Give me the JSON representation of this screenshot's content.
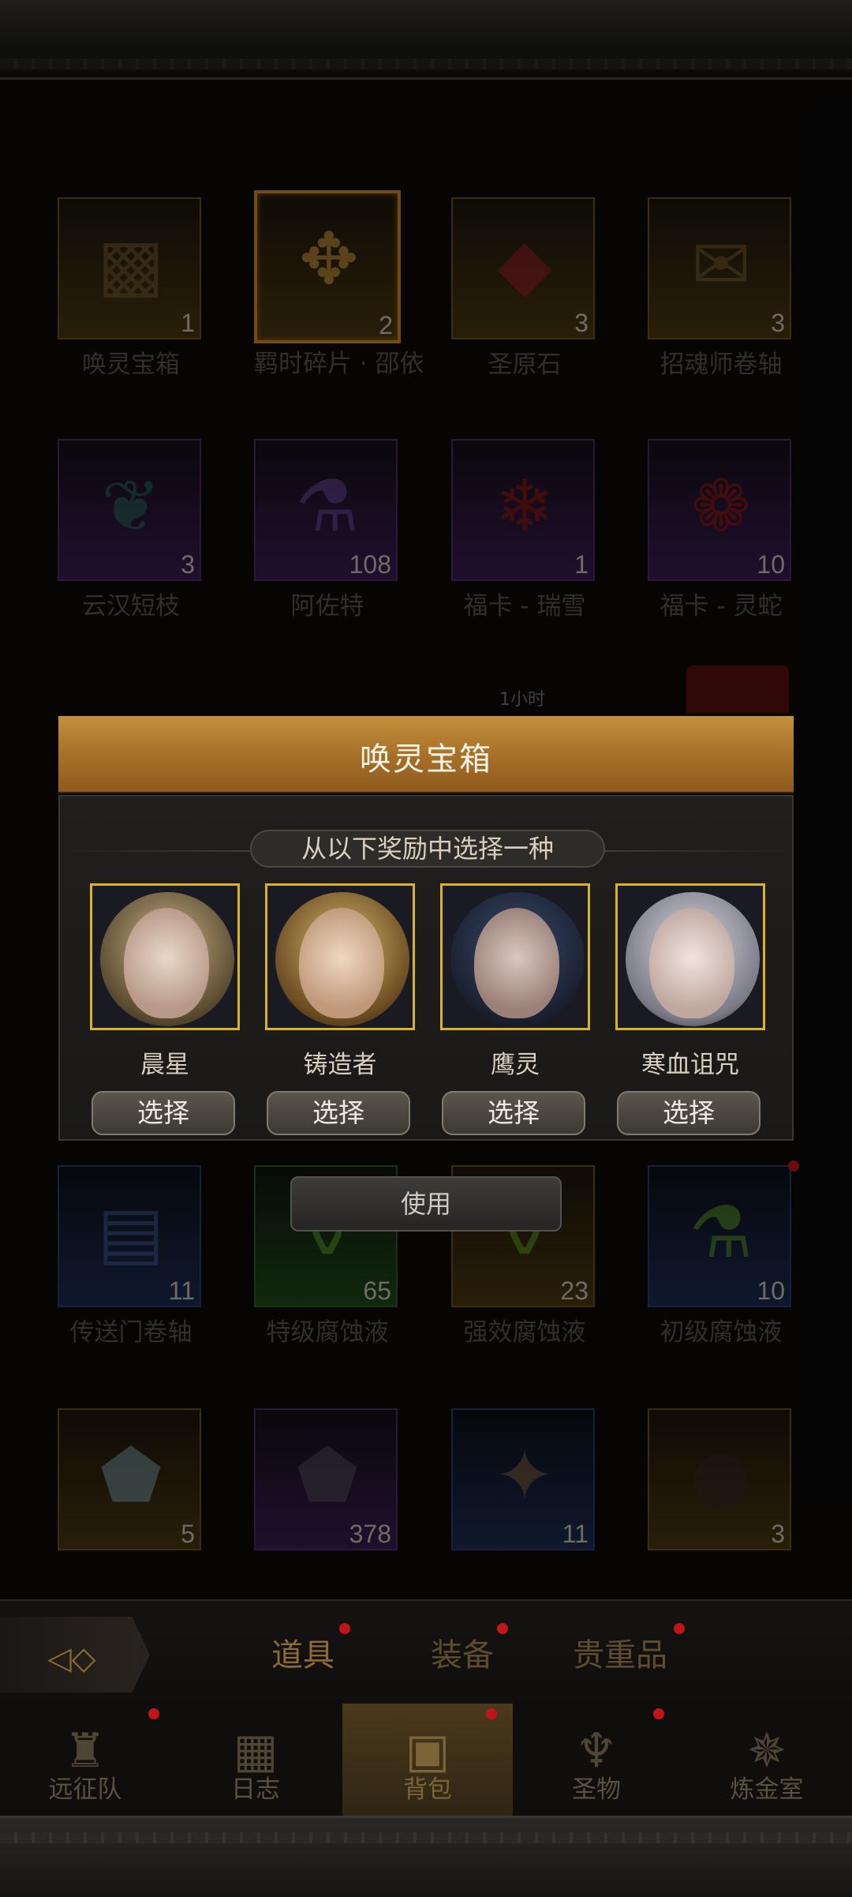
{
  "items": [
    {
      "name": "唤灵宝箱",
      "count": "1",
      "rarity": "gold",
      "icon": "chest-icon"
    },
    {
      "name": "羁时碎片 · 邵依",
      "count": "2",
      "rarity": "gold",
      "icon": "puzzle-piece-icon"
    },
    {
      "name": "圣原石",
      "count": "3",
      "rarity": "gold",
      "icon": "red-gem-icon"
    },
    {
      "name": "招魂师卷轴",
      "count": "3",
      "rarity": "gold",
      "icon": "scroll-icon"
    },
    {
      "name": "云汉短枝",
      "count": "3",
      "rarity": "purple",
      "icon": "branch-icon"
    },
    {
      "name": "阿佐特",
      "count": "108",
      "rarity": "purple",
      "icon": "purple-vial-icon"
    },
    {
      "name": "福卡 - 瑞雪",
      "count": "1",
      "rarity": "purple",
      "icon": "red-card-snowflake-icon"
    },
    {
      "name": "福卡 - 灵蛇",
      "count": "10",
      "rarity": "purple",
      "icon": "red-card-snake-icon"
    },
    {
      "name": "传送门卷轴",
      "count": "11",
      "rarity": "blue",
      "icon": "portal-scroll-icon"
    },
    {
      "name": "特级腐蚀液",
      "count": "65",
      "rarity": "green",
      "icon": "green-flask-icon"
    },
    {
      "name": "强效腐蚀液",
      "count": "23",
      "rarity": "gold",
      "icon": "green-flask-icon"
    },
    {
      "name": "初级腐蚀液",
      "count": "10",
      "rarity": "blue",
      "icon": "green-bottle-icon"
    },
    {
      "name": "",
      "count": "5",
      "rarity": "gold",
      "icon": "ice-ore-icon"
    },
    {
      "name": "",
      "count": "378",
      "rarity": "purple",
      "icon": "dark-ore-icon"
    },
    {
      "name": "",
      "count": "11",
      "rarity": "blue",
      "icon": "leather-hide-icon"
    },
    {
      "name": "",
      "count": "3",
      "rarity": "gold",
      "icon": "dark-fruit-icon"
    }
  ],
  "hidden_row_timer": "1小时",
  "modal": {
    "title": "唤灵宝箱",
    "prompt": "从以下奖励中选择一种",
    "choices": [
      {
        "name": "晨星",
        "button": "选择"
      },
      {
        "name": "铸造者",
        "button": "选择"
      },
      {
        "name": "鹰灵",
        "button": "选择"
      },
      {
        "name": "寒血诅咒",
        "button": "选择"
      }
    ]
  },
  "use_button": "使用",
  "tabs": [
    {
      "label": "道具",
      "active": true
    },
    {
      "label": "装备",
      "active": false
    },
    {
      "label": "贵重品",
      "active": false
    }
  ],
  "nav": [
    {
      "label": "远征队",
      "icon": "viking-helmet-icon",
      "active": false
    },
    {
      "label": "日志",
      "icon": "map-icon",
      "active": false
    },
    {
      "label": "背包",
      "icon": "backpack-icon",
      "active": true
    },
    {
      "label": "圣物",
      "icon": "chalice-icon",
      "active": false
    },
    {
      "label": "炼金室",
      "icon": "alchemy-icon",
      "active": false
    }
  ],
  "colors": {
    "accent": "#c48f3c",
    "dot": "#c0161b",
    "portrait_border": "#d9b328"
  }
}
